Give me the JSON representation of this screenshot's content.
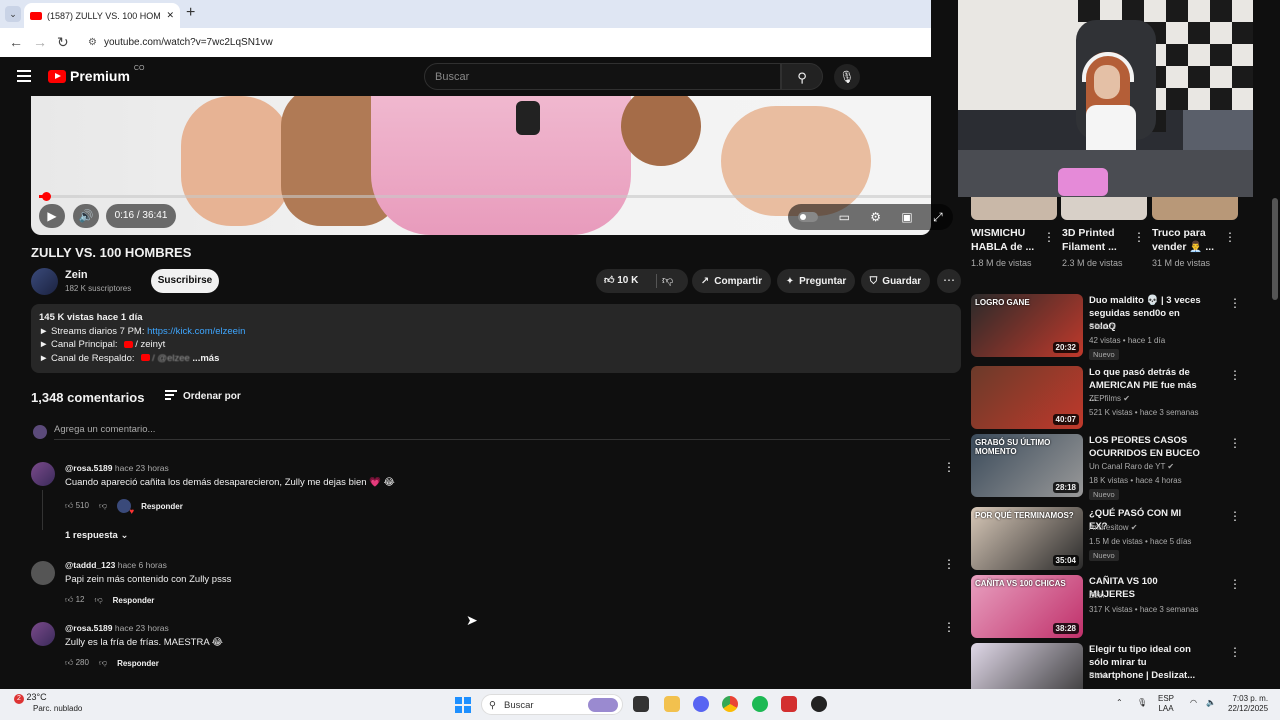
{
  "browser": {
    "tab_title": "(1587) ZULLY VS. 100 HOMBRES",
    "url": "youtube.com/watch?v=7wc2LqSN1vw"
  },
  "header": {
    "logo": "Premium",
    "logo_region": "CO",
    "search_placeholder": "Buscar"
  },
  "player": {
    "time": "0:16 / 36:41",
    "progress_fraction": 0.007
  },
  "video": {
    "title": "ZULLY VS. 100 HOMBRES",
    "channel": "Zein",
    "subscribers": "182 K suscriptores",
    "subscribe_label": "Suscribirse",
    "likes": "10 K",
    "share_label": "Compartir",
    "ask_label": "Preguntar",
    "save_label": "Guardar"
  },
  "description": {
    "stats": "145 K vistas  hace 1 día",
    "line1_prefix": "► Streams diarios 7 PM: ",
    "line1_link": "https://kick.com/elzeein",
    "line2_prefix": "► Canal Principal: ",
    "line2_value": "/ zeinyt",
    "line3_prefix": "► Canal de Respaldo: ",
    "line3_value": "/ @elzee",
    "more": "...más"
  },
  "comments": {
    "count": "1,348 comentarios",
    "sort_label": "Ordenar por",
    "add_placeholder": "Agrega un comentario...",
    "reply_label": "Responder",
    "items": [
      {
        "author": "@rosa.5189",
        "time": "hace 23 horas",
        "text": "Cuando apareció cañita los demás desaparecieron, Zully me dejas bien 💗 😂",
        "likes": "510"
      },
      {
        "author": "@taddd_123",
        "time": "hace 6 horas",
        "text": "Papi zein más contenido con Zully psss",
        "likes": "12"
      },
      {
        "author": "@rosa.5189",
        "time": "hace 23 horas",
        "text": "Zully es la fría de frías. MAESTRA 😂",
        "likes": "280"
      }
    ],
    "replies_label": "1 respuesta"
  },
  "shorts": [
    {
      "title1": "WISMICHU",
      "title2": "HABLA de ...",
      "views": "1.8 M de vistas"
    },
    {
      "title1": "3D Printed",
      "title2": "Filament ...",
      "views": "2.3 M de vistas"
    },
    {
      "title1": "Truco para",
      "title2": "vender 👨‍💼 ...",
      "views": "31 M de vistas"
    }
  ],
  "recommended": [
    {
      "title": "Duo maldito 💀 | 3 veces seguidas send0o en soloQ",
      "channel": "SilerLol",
      "meta": "42 vistas • hace 1 día",
      "badge": "Nuevo",
      "duration": "20:32",
      "colors": [
        "#2a2a2a",
        "#c0392b"
      ]
    },
    {
      "title": "Lo que pasó detrás de AMERICAN PIE fue más ...",
      "channel": "ZEPfilms",
      "meta": "521 K vistas • hace 3 semanas",
      "badge": "",
      "duration": "40:07",
      "colors": [
        "#6b3a2a",
        "#c0392b"
      ]
    },
    {
      "title": "LOS PEORES CASOS OCURRIDOS EN BUCEO",
      "channel": "Un Canal Raro de YT",
      "meta": "18 K vistas • hace 4 horas",
      "badge": "Nuevo",
      "duration": "28:18",
      "colors": [
        "#3a4a5a",
        "#999999"
      ]
    },
    {
      "title": "¿QUÉ PASÓ CON MI EX?",
      "channel": "Andresitow",
      "meta": "1.5 M de vistas • hace 5 días",
      "badge": "Nuevo",
      "duration": "35:04",
      "colors": [
        "#d8c8b8",
        "#2a2a2a"
      ]
    },
    {
      "title": "CAÑITA VS 100 MUJERES",
      "channel": "Zein",
      "meta": "317 K vistas • hace 3 semanas",
      "badge": "",
      "duration": "38:28",
      "colors": [
        "#e8a0c0",
        "#c0306a"
      ]
    },
    {
      "title": "Elegir tu tipo ideal con sólo mirar tu smartphone | Deslizat...",
      "channel": "Pixid",
      "meta": "",
      "badge": "",
      "duration": "",
      "colors": [
        "#e0d8e8",
        "#333333"
      ]
    }
  ],
  "thumb_texts": {
    "r0": "LOGRO GANE",
    "r2": "GRABÓ SU ÚLTIMO MOMENTO",
    "r3": "POR QUÉ TERMINAMOS?",
    "r4": "CAÑITA VS 100 CHICAS"
  },
  "taskbar": {
    "weather_temp": "23°C",
    "weather_desc": "Parc. nublado",
    "weather_badge": "2",
    "search": "Buscar",
    "lang1": "ESP",
    "lang2": "LAA",
    "time": "7:03 p. m.",
    "date": "22/12/2025"
  }
}
